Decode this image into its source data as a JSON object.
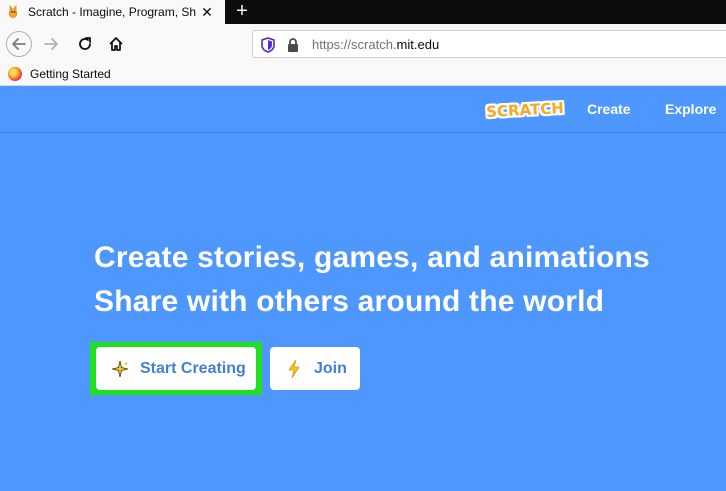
{
  "browser": {
    "tab_title": "Scratch - Imagine, Program, Sh",
    "tab_close": "✕",
    "new_tab": "+",
    "url_prefix": "https://scratch.",
    "url_domain": "mit.edu",
    "bookmark": "Getting Started",
    "icons": {
      "favicon": "scratch-cat-icon",
      "back": "back-arrow-icon",
      "forward": "forward-arrow-icon",
      "reload": "reload-icon",
      "home": "home-icon",
      "tracking": "shield-icon",
      "security": "lock-icon",
      "bookmark": "firefox-icon"
    }
  },
  "site": {
    "logo": "SCRATCH",
    "nav": [
      "Create",
      "Explore"
    ],
    "headline_1": "Create stories, games, and animations",
    "headline_2": "Share with others around the world",
    "start_button": "Start Creating",
    "join_button": "Join",
    "colors": {
      "background": "#4d97ff",
      "highlight": "#20e020",
      "logo": "#f7a826",
      "button_text": "#4280d7"
    }
  }
}
